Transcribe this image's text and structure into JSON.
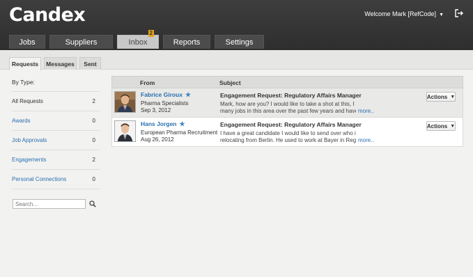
{
  "brand": {
    "logo": "Candex"
  },
  "header": {
    "welcome": "Welcome Mark  [RefCode]"
  },
  "tabs": [
    {
      "label": "Jobs"
    },
    {
      "label": "Suppliers"
    },
    {
      "label": "Inbox",
      "badge": "2"
    },
    {
      "label": "Reports"
    },
    {
      "label": "Settings"
    }
  ],
  "subtabs": [
    {
      "label": "Requests"
    },
    {
      "label": "Messages"
    },
    {
      "label": "Sent"
    }
  ],
  "sidebar": {
    "title": "By Type:",
    "items": [
      {
        "label": "All Requests",
        "count": "2"
      },
      {
        "label": "Awards",
        "count": "0"
      },
      {
        "label": "Job Approvals",
        "count": "0"
      },
      {
        "label": "Engagements",
        "count": "2"
      },
      {
        "label": "Personal Connections",
        "count": "0"
      }
    ],
    "search_placeholder": "Search..."
  },
  "table": {
    "headers": {
      "from": "From",
      "subject": "Subject"
    },
    "rows": [
      {
        "name": "Fabrice Giroux",
        "company": "Pharma Specialists",
        "date": "Sep 3, 2012",
        "subject": "Engagement Request: Regulatory Affairs Manager",
        "line1": "Mark, how are you? I would like to take a shot at this, I have filled",
        "line2": "many jobs in this area over the past few years and have an",
        "more": "more..",
        "actions": "Actions"
      },
      {
        "name": "Hans Jorgen",
        "company": "European Pharma Recruitment",
        "date": "Aug 26, 2012",
        "subject": "Engagement Request: Regulatory Affairs Manager",
        "line1": "I have a great candidate I would like to send over who is",
        "line2": "relocating from Berlin. He used to work at Bayer in Regulatory",
        "more": "more..",
        "actions": "Actions"
      }
    ]
  },
  "colors": {
    "accent": "#e3a21a",
    "link": "#2a6fb0",
    "topbar": "#333333"
  }
}
